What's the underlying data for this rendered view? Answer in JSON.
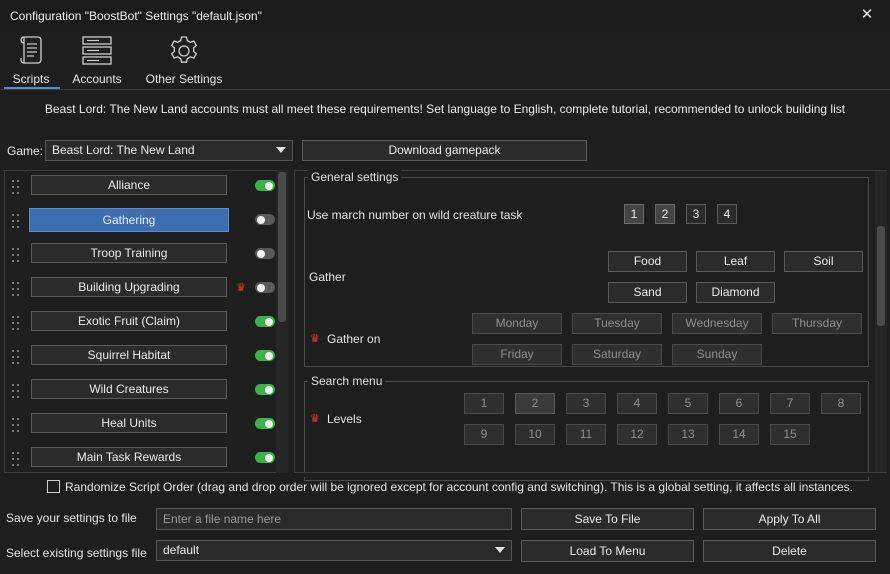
{
  "window": {
    "title": "Configuration \"BoostBot\" Settings \"default.json\"",
    "close_glyph": "✕"
  },
  "tabs": [
    {
      "label": "Scripts",
      "icon": "scroll-icon",
      "active": true
    },
    {
      "label": "Accounts",
      "icon": "server-icon",
      "active": false
    },
    {
      "label": "Other Settings",
      "icon": "gear-icon",
      "active": false
    }
  ],
  "notice": "Beast Lord: The New Land accounts must all meet these requirements! Set language to English, complete tutorial, recommended to unlock building list",
  "game": {
    "label": "Game:",
    "selected": "Beast Lord: The New Land",
    "download_button": "Download gamepack"
  },
  "scripts": [
    {
      "label": "Alliance",
      "enabled": true,
      "premium": false,
      "active": false
    },
    {
      "label": "Gathering",
      "enabled": false,
      "premium": false,
      "active": true
    },
    {
      "label": "Troop Training",
      "enabled": false,
      "premium": false,
      "active": false
    },
    {
      "label": "Building Upgrading",
      "enabled": false,
      "premium": true,
      "active": false
    },
    {
      "label": "Exotic Fruit (Claim)",
      "enabled": true,
      "premium": false,
      "active": false
    },
    {
      "label": "Squirrel Habitat",
      "enabled": true,
      "premium": false,
      "active": false
    },
    {
      "label": "Wild Creatures",
      "enabled": true,
      "premium": false,
      "active": false
    },
    {
      "label": "Heal Units",
      "enabled": true,
      "premium": false,
      "active": false
    },
    {
      "label": "Main Task Rewards",
      "enabled": true,
      "premium": false,
      "active": false
    }
  ],
  "general": {
    "title": "General settings",
    "march_label": "Use march number on wild creature task",
    "march_numbers": [
      {
        "label": "1",
        "selected": true
      },
      {
        "label": "2",
        "selected": true
      },
      {
        "label": "3",
        "selected": false
      },
      {
        "label": "4",
        "selected": false
      }
    ],
    "gather_label": "Gather",
    "gather_options": [
      "Food",
      "Leaf",
      "Soil",
      "Sand",
      "Diamond"
    ],
    "gather_on_label": "Gather on",
    "days": [
      "Monday",
      "Tuesday",
      "Wednesday",
      "Thursday",
      "Friday",
      "Saturday",
      "Sunday"
    ]
  },
  "search": {
    "title": "Search menu",
    "levels_label": "Levels",
    "levels": [
      {
        "label": "1",
        "selected": false
      },
      {
        "label": "2",
        "selected": true
      },
      {
        "label": "3",
        "selected": false
      },
      {
        "label": "4",
        "selected": false
      },
      {
        "label": "5",
        "selected": false
      },
      {
        "label": "6",
        "selected": false
      },
      {
        "label": "7",
        "selected": false
      },
      {
        "label": "8",
        "selected": false
      },
      {
        "label": "9",
        "selected": false
      },
      {
        "label": "10",
        "selected": false
      },
      {
        "label": "11",
        "selected": false
      },
      {
        "label": "12",
        "selected": false
      },
      {
        "label": "13",
        "selected": false
      },
      {
        "label": "14",
        "selected": false
      },
      {
        "label": "15",
        "selected": false
      }
    ]
  },
  "crown_glyph": "♛",
  "randomize": {
    "checked": false,
    "label": "Randomize Script Order (drag and drop order will be ignored except for account config and switching). This is a global setting, it affects all instances."
  },
  "save": {
    "label": "Save your settings to file",
    "placeholder": "Enter a file name here",
    "save_button": "Save To File",
    "apply_button": "Apply To All"
  },
  "load": {
    "label": "Select existing settings file",
    "selected": "default",
    "load_button": "Load To Menu",
    "delete_button": "Delete"
  },
  "colors": {
    "accent": "#3d6fb0",
    "toggle_on": "#3bb34a",
    "premium": "#e23a3a"
  }
}
